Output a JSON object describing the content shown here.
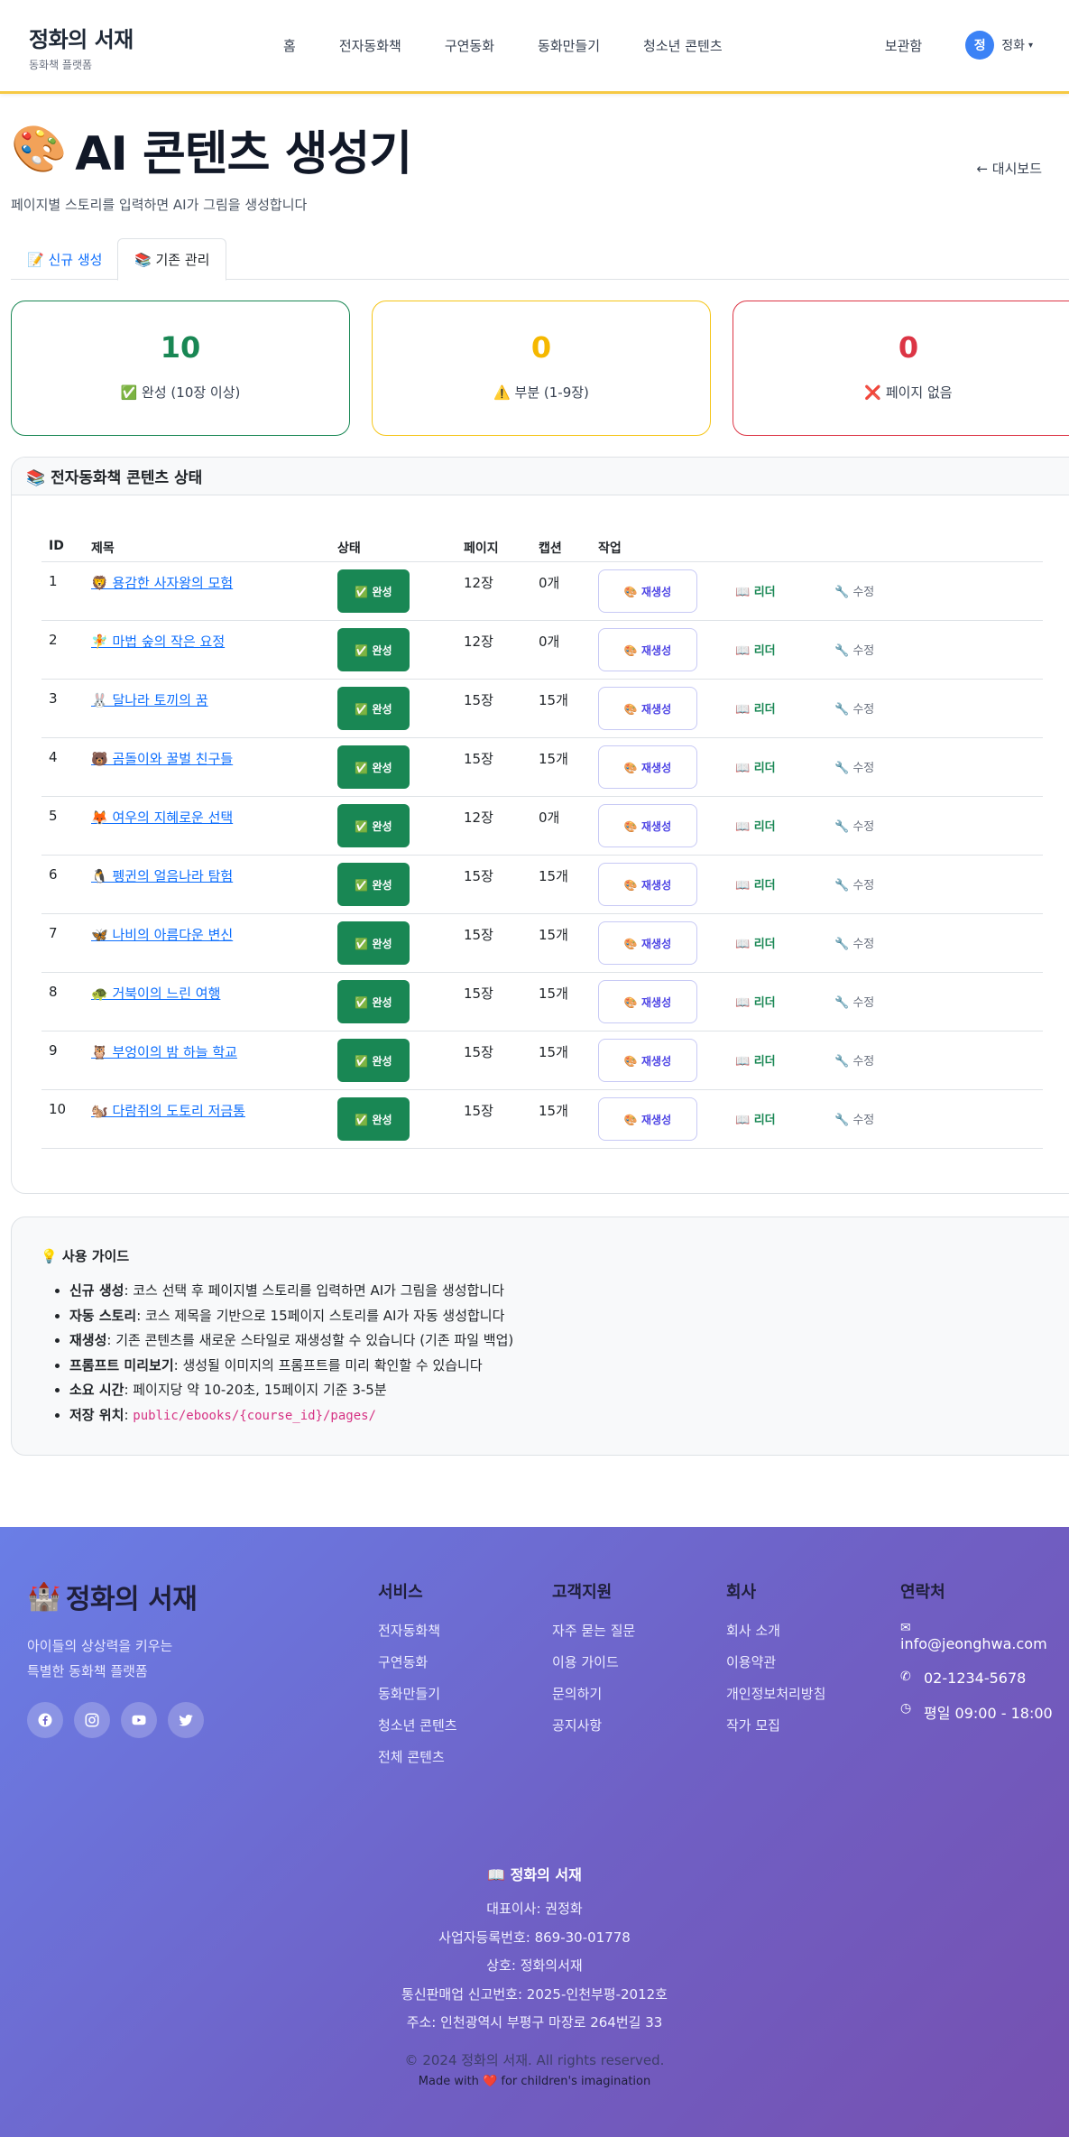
{
  "navbar": {
    "brand_title": "정화의 서재",
    "brand_sub": "동화책 플랫폼",
    "links": [
      "홈",
      "전자동화책",
      "구연동화",
      "동화만들기",
      "청소년 콘텐츠"
    ],
    "storage": "보관함",
    "avatar_initial": "정",
    "user_name": "정화"
  },
  "header": {
    "emoji": "🎨",
    "title": "AI 콘텐츠 생성기",
    "subtitle": "페이지별 스토리를 입력하면 AI가 그림을 생성합니다",
    "dashboard_link": "← 대시보드"
  },
  "tabs": {
    "new": "📝 신규 생성",
    "manage": "📚 기존 관리"
  },
  "stats": {
    "complete": {
      "value": "10",
      "label": "✅ 완성 (10장 이상)"
    },
    "partial": {
      "value": "0",
      "label": "⚠️ 부분 (1-9장)"
    },
    "none": {
      "value": "0",
      "label": "❌ 페이지 없음"
    }
  },
  "table": {
    "card_title": "📚 전자동화책 콘텐츠 상태",
    "headers": {
      "id": "ID",
      "title": "제목",
      "status": "상태",
      "pages": "페이지",
      "captions": "캡션",
      "action": "작업"
    },
    "regen_label": "🎨 재생성",
    "reader_label": "📖 리더",
    "edit_label": "🔧 수정",
    "rows": [
      {
        "id": "1",
        "title": "🦁 용감한 사자왕의 모험",
        "status": "✅ 완성",
        "pages": "12장",
        "captions": "0개"
      },
      {
        "id": "2",
        "title": "🧚 마법 숲의 작은 요정",
        "status": "✅ 완성",
        "pages": "12장",
        "captions": "0개"
      },
      {
        "id": "3",
        "title": "🐰 달나라 토끼의 꿈",
        "status": "✅ 완성",
        "pages": "15장",
        "captions": "15개"
      },
      {
        "id": "4",
        "title": "🐻 곰돌이와 꿀벌 친구들",
        "status": "✅ 완성",
        "pages": "15장",
        "captions": "15개"
      },
      {
        "id": "5",
        "title": "🦊 여우의 지혜로운 선택",
        "status": "✅ 완성",
        "pages": "12장",
        "captions": "0개"
      },
      {
        "id": "6",
        "title": "🐧 펭귄의 얼음나라 탐험",
        "status": "✅ 완성",
        "pages": "15장",
        "captions": "15개"
      },
      {
        "id": "7",
        "title": "🦋 나비의 아름다운 변신",
        "status": "✅ 완성",
        "pages": "15장",
        "captions": "15개"
      },
      {
        "id": "8",
        "title": "🐢 거북이의 느린 여행",
        "status": "✅ 완성",
        "pages": "15장",
        "captions": "15개"
      },
      {
        "id": "9",
        "title": "🦉 부엉이의 밤 하늘 학교",
        "status": "✅ 완성",
        "pages": "15장",
        "captions": "15개"
      },
      {
        "id": "10",
        "title": "🐿️ 다람쥐의 도토리 저금통",
        "status": "✅ 완성",
        "pages": "15장",
        "captions": "15개"
      }
    ]
  },
  "guide": {
    "title": "💡 사용 가이드",
    "items": [
      {
        "term": "신규 생성",
        "text": ": 코스 선택 후 페이지별 스토리를 입력하면 AI가 그림을 생성합니다"
      },
      {
        "term": "자동 스토리",
        "text": ": 코스 제목을 기반으로 15페이지 스토리를 AI가 자동 생성합니다"
      },
      {
        "term": "재생성",
        "text": ": 기존 콘텐츠를 새로운 스타일로 재생성할 수 있습니다 (기존 파일 백업)"
      },
      {
        "term": "프롬프트 미리보기",
        "text": ": 생성될 이미지의 프롬프트를 미리 확인할 수 있습니다"
      },
      {
        "term": "소요 시간",
        "text": ": 페이지당 약 10-20초, 15페이지 기준 3-5분"
      },
      {
        "term": "저장 위치",
        "text": ": ",
        "code": "public/ebooks/{course_id}/pages/"
      }
    ]
  },
  "footer": {
    "brand": "정화의 서재",
    "brand_emoji": "🏰",
    "desc_line1": "아이들의 상상력을 키우는",
    "desc_line2": "특별한 동화책 플랫폼",
    "socials": [
      "facebook-icon",
      "instagram-icon",
      "youtube-icon",
      "twitter-icon"
    ],
    "columns": [
      {
        "title": "서비스",
        "items": [
          "전자동화책",
          "구연동화",
          "동화만들기",
          "청소년 콘텐츠",
          "전체 콘텐츠"
        ]
      },
      {
        "title": "고객지원",
        "items": [
          "자주 묻는 질문",
          "이용 가이드",
          "문의하기",
          "공지사항"
        ]
      },
      {
        "title": "회사",
        "items": [
          "회사 소개",
          "이용약관",
          "개인정보처리방침",
          "작가 모집"
        ]
      }
    ],
    "contact": {
      "title": "연락처",
      "email_label": "info@jeonghwa.com",
      "phone": "02-1234-5678",
      "hours": "평일 09:00 - 18:00"
    },
    "bottom": {
      "name": "📖 정화의 서재",
      "ceo": "대표이사: 권정화",
      "biz_no": "사업자등록번호: 869-30-01778",
      "company": "상호: 정화의서재",
      "ecommerce": "통신판매업 신고번호: 2025-인천부평-2012호",
      "address": "주소: 인천광역시 부평구 마장로 264번길 33",
      "copyright": "© 2024 정화의 서재. All rights reserved.",
      "made_with": "Made with ❤️ for children's imagination"
    }
  },
  "colors": {
    "accent_yellow": "#f6c944",
    "success": "#198754",
    "warning": "#f5b800",
    "danger": "#dc3545",
    "link": "#0d6efd",
    "footer_start": "#6a7ee6",
    "footer_end": "#7650b0"
  }
}
